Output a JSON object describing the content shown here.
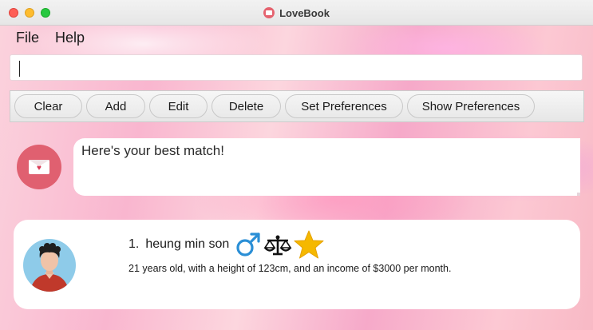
{
  "window": {
    "title": "LoveBook"
  },
  "menu": {
    "items": [
      "File",
      "Help"
    ]
  },
  "command": {
    "value": ""
  },
  "toolbar": {
    "buttons": [
      "Clear",
      "Add",
      "Edit",
      "Delete",
      "Set Preferences",
      "Show Preferences"
    ]
  },
  "result": {
    "message": "Here's your best match!"
  },
  "match": {
    "index": "1.",
    "name": "heung min son",
    "description": "21 years old, with a height of 123cm, and an income of $3000 per month.",
    "icons": [
      "male-icon",
      "libra-icon",
      "star-icon"
    ]
  },
  "colors": {
    "accent": "#e06070",
    "male_icon": "#2b8fd6",
    "star_icon": "#f5b800",
    "avatar_bg": "#8ecbe9",
    "shirt": "#c0392b"
  }
}
